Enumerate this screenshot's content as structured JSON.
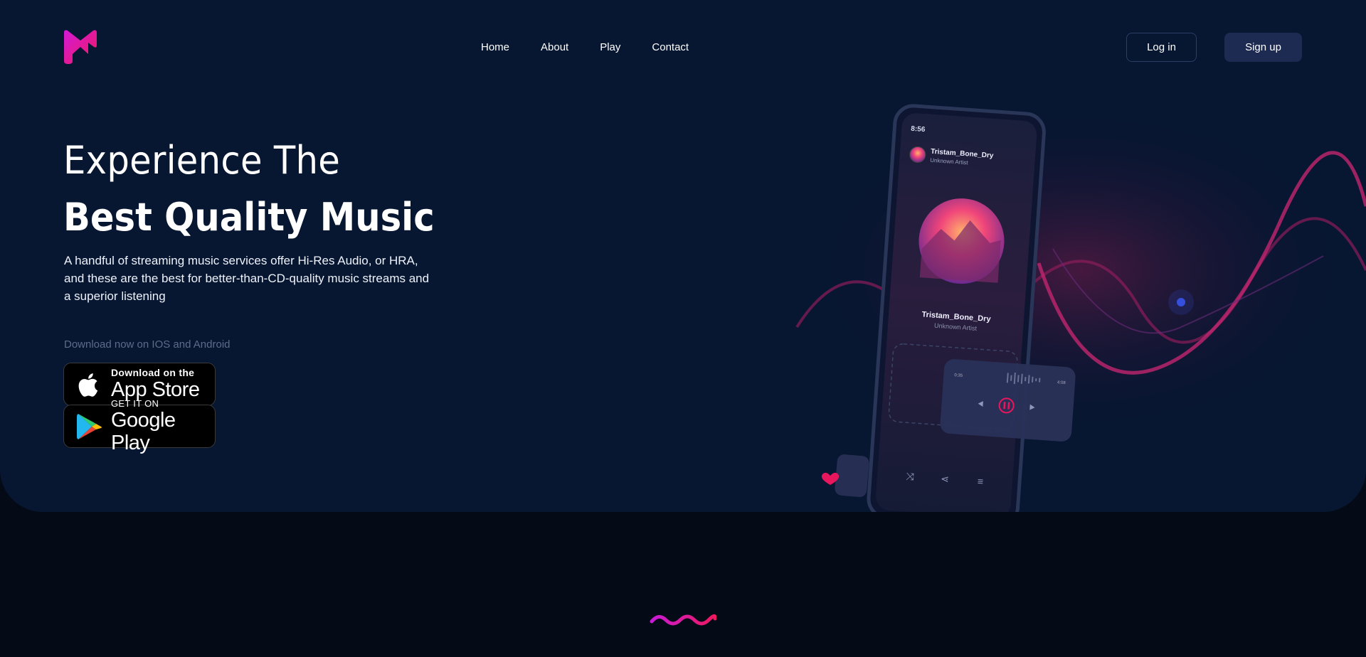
{
  "nav": {
    "links": [
      "Home",
      "About",
      "Play",
      "Contact"
    ],
    "login_label": "Log in",
    "signup_label": "Sign up"
  },
  "hero": {
    "title_line1": "Experience The",
    "title_line2": "Best Quality Music",
    "description": "A handful of streaming music services offer Hi-Res Audio, or HRA, and these are the best for better-than-CD-quality music streams and a superior listening",
    "download_note": "Download now on IOS and Android"
  },
  "badges": {
    "apple_small": "Download on the",
    "apple_big": "App Store",
    "google_small": "GET IT ON",
    "google_big": "Google Play"
  },
  "phone": {
    "status_time": "8:56",
    "track_name": "Tristam_Bone_Dry",
    "artist": "Unknown Artist",
    "player_time_left": "0:35",
    "player_time_right": "4:08"
  },
  "colors": {
    "hero_bg": "#071631",
    "page_bg": "#050a17",
    "accent_pink": "#e8175d",
    "accent_magenta": "#c81bd6",
    "signup_bg": "#1d2a52"
  }
}
